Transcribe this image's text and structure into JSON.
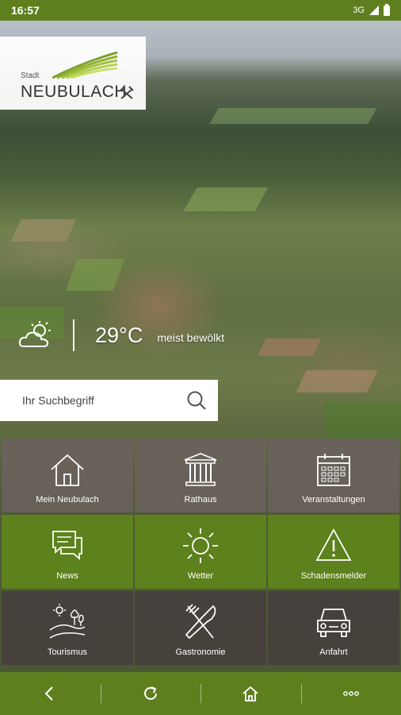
{
  "status_bar": {
    "time": "16:57",
    "network": "3G"
  },
  "logo": {
    "prefix": "Stadt",
    "name": "NEUBULACH"
  },
  "weather": {
    "temperature": "29°C",
    "condition": "meist bewölkt",
    "icon": "partly-cloudy-icon"
  },
  "search": {
    "placeholder": "Ihr Suchbegriff"
  },
  "tiles": [
    {
      "label": "Mein Neubulach",
      "icon": "house-icon"
    },
    {
      "label": "Rathaus",
      "icon": "townhall-icon"
    },
    {
      "label": "Veranstaltungen",
      "icon": "calendar-icon"
    },
    {
      "label": "News",
      "icon": "chat-bubbles-icon"
    },
    {
      "label": "Wetter",
      "icon": "sun-icon"
    },
    {
      "label": "Schadensmelder",
      "icon": "warning-icon"
    },
    {
      "label": "Tourismus",
      "icon": "landscape-icon"
    },
    {
      "label": "Gastronomie",
      "icon": "cutlery-icon"
    },
    {
      "label": "Anfahrt",
      "icon": "car-icon"
    }
  ],
  "bottom_nav": [
    "back-icon",
    "refresh-icon",
    "home-icon",
    "more-icon"
  ],
  "colors": {
    "brand_green": "#5f7f1f",
    "tile_grey": "#69625c",
    "tile_green": "#5e841b",
    "tile_dark": "#46403c"
  }
}
